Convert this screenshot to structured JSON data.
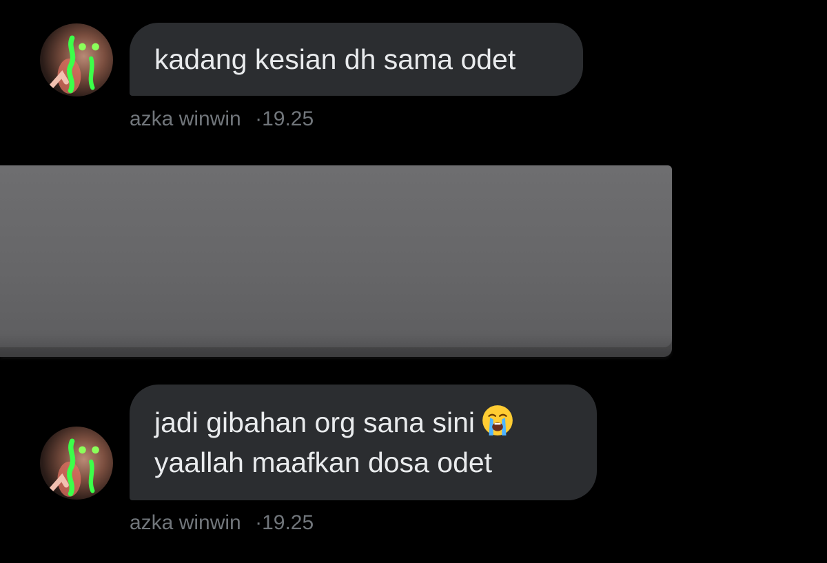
{
  "messages": [
    {
      "lines": [
        "kadang kesian dh sama odet"
      ],
      "sender": "azka winwin",
      "time": "19.25",
      "separator": "·"
    },
    {
      "lines": [
        "jadi gibahan org sana sini",
        "yaallah maafkan dosa odet"
      ],
      "emoji": "loudly-crying-face",
      "sender": "azka winwin",
      "time": "19.25",
      "separator": "·"
    }
  ],
  "colors": {
    "background": "#000000",
    "bubble": "#2b2d30",
    "text": "#e9ebed",
    "meta": "#71767b",
    "redaction": "#666668"
  }
}
